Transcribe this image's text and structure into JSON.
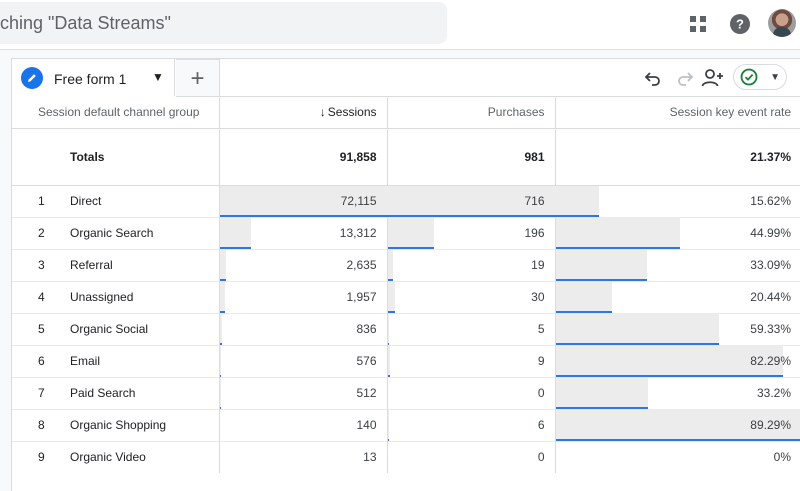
{
  "search": {
    "text": "ching \"Data Streams\""
  },
  "header": {
    "icons": [
      "apps-icon",
      "help-icon",
      "avatar"
    ]
  },
  "tabs": [
    {
      "label": "Free form 1"
    }
  ],
  "table": {
    "columns": [
      "Session default channel group",
      "Sessions",
      "Purchases",
      "Session key event rate"
    ],
    "sort_indicator": "↓",
    "totals": {
      "label": "Totals",
      "sessions": "91,858",
      "purchases": "981",
      "rate": "21.37%"
    },
    "rows": [
      {
        "idx": "1",
        "name": "Direct",
        "sessions": "72,115",
        "purchases": "716",
        "rate": "15.62%",
        "sessions_frac": 1.0,
        "purchases_frac": 1.0,
        "rate_frac": 0.175
      },
      {
        "idx": "2",
        "name": "Organic Search",
        "sessions": "13,312",
        "purchases": "196",
        "rate": "44.99%",
        "sessions_frac": 0.185,
        "purchases_frac": 0.274,
        "rate_frac": 0.504
      },
      {
        "idx": "3",
        "name": "Referral",
        "sessions": "2,635",
        "purchases": "19",
        "rate": "33.09%",
        "sessions_frac": 0.037,
        "purchases_frac": 0.027,
        "rate_frac": 0.371
      },
      {
        "idx": "4",
        "name": "Unassigned",
        "sessions": "1,957",
        "purchases": "30",
        "rate": "20.44%",
        "sessions_frac": 0.027,
        "purchases_frac": 0.042,
        "rate_frac": 0.229
      },
      {
        "idx": "5",
        "name": "Organic Social",
        "sessions": "836",
        "purchases": "5",
        "rate": "59.33%",
        "sessions_frac": 0.012,
        "purchases_frac": 0.007,
        "rate_frac": 0.664
      },
      {
        "idx": "6",
        "name": "Email",
        "sessions": "576",
        "purchases": "9",
        "rate": "82.29%",
        "sessions_frac": 0.008,
        "purchases_frac": 0.013,
        "rate_frac": 0.921
      },
      {
        "idx": "7",
        "name": "Paid Search",
        "sessions": "512",
        "purchases": "0",
        "rate": "33.2%",
        "sessions_frac": 0.007,
        "purchases_frac": 0.0,
        "rate_frac": 0.372
      },
      {
        "idx": "8",
        "name": "Organic Shopping",
        "sessions": "140",
        "purchases": "6",
        "rate": "89.29%",
        "sessions_frac": 0.002,
        "purchases_frac": 0.008,
        "rate_frac": 1.0
      },
      {
        "idx": "9",
        "name": "Organic Video",
        "sessions": "13",
        "purchases": "0",
        "rate": "0%",
        "sessions_frac": 0.0,
        "purchases_frac": 0.0,
        "rate_frac": 0.0
      }
    ]
  },
  "colors": {
    "accent": "#1a73e8",
    "bar": "#3275e0",
    "barbg": "#ececec",
    "ok": "#188038"
  }
}
